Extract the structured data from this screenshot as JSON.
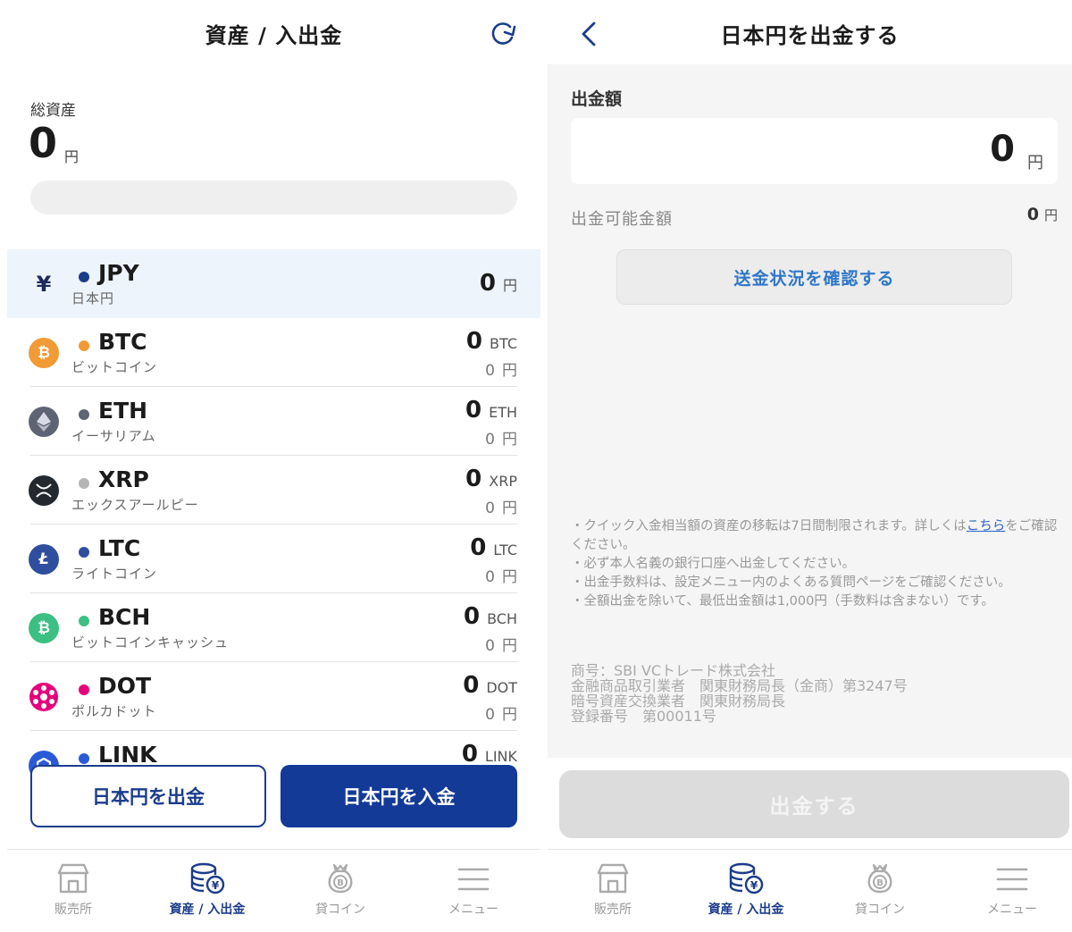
{
  "left": {
    "header_title": "資産 / 入出金",
    "total": {
      "label": "総資産",
      "value": "0",
      "unit": "円"
    },
    "assets": [
      {
        "symbol": "JPY",
        "name": "日本円",
        "amount": "0",
        "unit": "円",
        "dot_color": "#1b3c8c",
        "icon": "yen-icon"
      },
      {
        "symbol": "BTC",
        "name": "ビットコイン",
        "amount": "0",
        "unit": "BTC",
        "yen": "0",
        "yen_unit": "円",
        "dot_color": "#f29a34",
        "icon": "bitcoin-icon"
      },
      {
        "symbol": "ETH",
        "name": "イーサリアム",
        "amount": "0",
        "unit": "ETH",
        "yen": "0",
        "yen_unit": "円",
        "dot_color": "#5f6474",
        "icon": "ethereum-icon"
      },
      {
        "symbol": "XRP",
        "name": "エックスアールピー",
        "amount": "0",
        "unit": "XRP",
        "yen": "0",
        "yen_unit": "円",
        "dot_color": "#b5b5b5",
        "icon": "xrp-icon"
      },
      {
        "symbol": "LTC",
        "name": "ライトコイン",
        "amount": "0",
        "unit": "LTC",
        "yen": "0",
        "yen_unit": "円",
        "dot_color": "#2f4f9e",
        "icon": "litecoin-icon"
      },
      {
        "symbol": "BCH",
        "name": "ビットコインキャッシュ",
        "amount": "0",
        "unit": "BCH",
        "yen": "0",
        "yen_unit": "円",
        "dot_color": "#3cbf82",
        "icon": "bitcoin-cash-icon"
      },
      {
        "symbol": "DOT",
        "name": "ポルカドット",
        "amount": "0",
        "unit": "DOT",
        "yen": "0",
        "yen_unit": "円",
        "dot_color": "#e6007a",
        "icon": "polkadot-icon"
      },
      {
        "symbol": "LINK",
        "name": "",
        "amount": "0",
        "unit": "LINK",
        "yen": "",
        "yen_unit": "",
        "dot_color": "#2a5ada",
        "icon": "chainlink-icon"
      }
    ],
    "buttons": {
      "withdraw": "日本円を出金",
      "deposit": "日本円を入金"
    },
    "tabs": [
      {
        "label": "販売所",
        "icon": "shop-icon"
      },
      {
        "label": "資産 / 入出金",
        "icon": "coins-yen-icon"
      },
      {
        "label": "貸コイン",
        "icon": "coin-bag-icon"
      },
      {
        "label": "メニュー",
        "icon": "menu-icon"
      }
    ]
  },
  "right": {
    "header_title": "日本円を出金する",
    "withdraw_label": "出金額",
    "amount": {
      "value": "0",
      "unit": "円"
    },
    "available": {
      "label": "出金可能金額",
      "value": "0",
      "unit": "円"
    },
    "status_button": "送金状況を確認する",
    "notes": {
      "n1_pre": "・クイック入金相当額の資産の移転は7日間制限されます。詳しくは",
      "n1_link": "こちら",
      "n1_post": "をご確認ください。",
      "n2": "・必ず本人名義の銀行口座へ出金してください。",
      "n3": "・出金手数料は、設定メニュー内のよくある質問ページをご確認ください。",
      "n4": "・全額出金を除いて、最低出金額は1,000円（手数料は含まない）です。"
    },
    "company": [
      "商号：SBI VCトレード株式会社",
      "金融商品取引業者　関東財務局長（金商）第3247号",
      "暗号資産交換業者　関東財務局長",
      "登録番号　第00011号"
    ],
    "submit_button": "出金する",
    "tabs": [
      {
        "label": "販売所",
        "icon": "shop-icon"
      },
      {
        "label": "資産 / 入出金",
        "icon": "coins-yen-icon"
      },
      {
        "label": "貸コイン",
        "icon": "coin-bag-icon"
      },
      {
        "label": "メニュー",
        "icon": "menu-icon"
      }
    ]
  },
  "colors": {
    "brand": "#123a96",
    "link": "#2e77c8",
    "active_tab": "#1b3c8c"
  }
}
